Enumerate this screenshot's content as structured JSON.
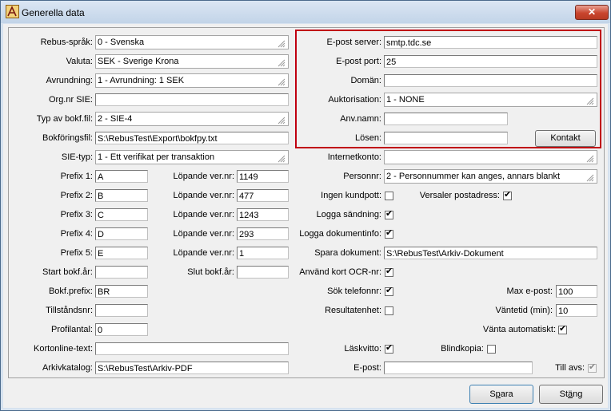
{
  "window": {
    "title": "Generella data",
    "close_label": "✕"
  },
  "left": {
    "rebus_sprak": {
      "label": "Rebus-språk:",
      "value": "0      - Svenska"
    },
    "valuta": {
      "label": "Valuta:",
      "value": "SEK  - Sverige Krona"
    },
    "avrundning": {
      "label": "Avrundning:",
      "value": "1      - Avrundning: 1 SEK"
    },
    "orgnr": {
      "label": "Org.nr SIE:",
      "value": ""
    },
    "typ_bokf": {
      "label": "Typ av bokf.fil:",
      "value": "2      - SIE-4"
    },
    "bokforingsfil": {
      "label": "Bokföringsfil:",
      "value": "S:\\RebusTest\\Export\\bokfpy.txt"
    },
    "sie_typ": {
      "label": "SIE-typ:",
      "value": "1      - Ett verifikat per transaktion"
    },
    "prefixes": [
      {
        "label": "Prefix 1:",
        "value": "A",
        "ver_label": "Löpande ver.nr:",
        "ver_value": "1149"
      },
      {
        "label": "Prefix 2:",
        "value": "B",
        "ver_label": "Löpande ver.nr:",
        "ver_value": "477"
      },
      {
        "label": "Prefix 3:",
        "value": "C",
        "ver_label": "Löpande ver.nr:",
        "ver_value": "1243"
      },
      {
        "label": "Prefix 4:",
        "value": "D",
        "ver_label": "Löpande ver.nr:",
        "ver_value": "293"
      },
      {
        "label": "Prefix 5:",
        "value": "E",
        "ver_label": "Löpande ver.nr:",
        "ver_value": "1"
      }
    ],
    "start_bokfar": {
      "label": "Start bokf.år:",
      "value": ""
    },
    "slut_bokfar": {
      "label": "Slut bokf.år:",
      "value": ""
    },
    "bokf_prefix": {
      "label": "Bokf.prefix:",
      "value": "BR"
    },
    "tillstandsnr": {
      "label": "Tillståndsnr:",
      "value": ""
    },
    "profilantal": {
      "label": "Profilantal:",
      "value": "0"
    },
    "kortonline": {
      "label": "Kortonline-text:",
      "value": ""
    },
    "arkivkatalog": {
      "label": "Arkivkatalog:",
      "value": "S:\\RebusTest\\Arkiv-PDF"
    }
  },
  "right": {
    "epost_server": {
      "label": "E-post server:",
      "value": "smtp.tdc.se"
    },
    "epost_port": {
      "label": "E-post port:",
      "value": "25"
    },
    "doman": {
      "label": "Domän:",
      "value": ""
    },
    "auktorisation": {
      "label": "Auktorisation:",
      "value": "1   - NONE"
    },
    "anv_namn": {
      "label": "Anv.namn:",
      "value": ""
    },
    "losen": {
      "label": "Lösen:",
      "value": ""
    },
    "kontakt_label": "Kontakt",
    "internetkonto": {
      "label": "Internetkonto:",
      "value": ""
    },
    "personnr": {
      "label": "Personnr:",
      "value": "2      - Personnummer kan anges, annars blankt"
    },
    "ingen_kundpott": {
      "label": "Ingen kundpott:",
      "checked": false
    },
    "versaler_postadress": {
      "label": "Versaler postadress:",
      "checked": true
    },
    "logga_sandning": {
      "label": "Logga sändning:",
      "checked": true
    },
    "logga_dokumentinfo": {
      "label": "Logga dokumentinfo:",
      "checked": true
    },
    "spara_dokument": {
      "label": "Spara dokument:",
      "value": "S:\\RebusTest\\Arkiv-Dokument"
    },
    "anvand_kort_ocr": {
      "label": "Använd kort OCR-nr:",
      "checked": true
    },
    "sok_telefonnr": {
      "label": "Sök telefonnr:",
      "checked": true
    },
    "max_epost": {
      "label": "Max e-post:",
      "value": "100"
    },
    "resultatenhet": {
      "label": "Resultatenhet:",
      "checked": false
    },
    "vantetid": {
      "label": "Väntetid (min):",
      "value": "10"
    },
    "vanta_automatiskt": {
      "label": "Vänta automatiskt:",
      "checked": true
    },
    "laskvitto": {
      "label": "Läskvitto:",
      "checked": true
    },
    "blindkopia": {
      "label": "Blindkopia:",
      "checked": false
    },
    "epost": {
      "label": "E-post:",
      "value": ""
    },
    "till_avs": {
      "label": "Till avs:",
      "checked": true
    }
  },
  "footer": {
    "spara_pre": "S",
    "spara_u": "p",
    "spara_post": "ara",
    "stang_pre": "St",
    "stang_u": "ä",
    "stang_post": "ng"
  }
}
